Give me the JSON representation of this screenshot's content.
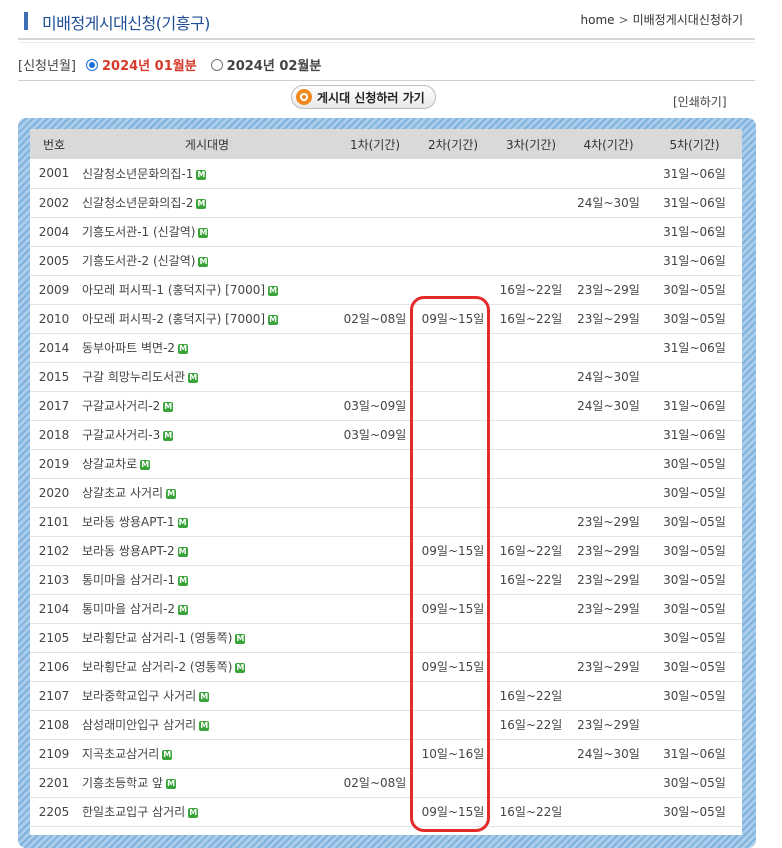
{
  "header": {
    "title": "미배정게시대신청(기흥구)",
    "breadcrumb_home": "home",
    "breadcrumb_sep": ">",
    "breadcrumb_current": "미배정게시대신청하기"
  },
  "month_select": {
    "label": "[신청년월]",
    "options": [
      {
        "label": "2024년 01월분",
        "selected": true
      },
      {
        "label": "2024년 02월분",
        "selected": false
      }
    ]
  },
  "actions": {
    "apply_label": "게시대 신청하러 가기",
    "print_label": "[인쇄하기]"
  },
  "table": {
    "columns": [
      "번호",
      "게시대명",
      "1차(기간)",
      "2차(기간)",
      "3차(기간)",
      "4차(기간)",
      "5차(기간)"
    ],
    "badge": "M",
    "rows": [
      {
        "no": "2001",
        "name": "신갈청소년문화의집-1",
        "p1": "",
        "p2": "",
        "p3": "",
        "p4": "",
        "p5": "31일~06일"
      },
      {
        "no": "2002",
        "name": "신갈청소년문화의집-2",
        "p1": "",
        "p2": "",
        "p3": "",
        "p4": "24일~30일",
        "p5": "31일~06일"
      },
      {
        "no": "2004",
        "name": "기흥도서관-1 (신갈역)",
        "p1": "",
        "p2": "",
        "p3": "",
        "p4": "",
        "p5": "31일~06일"
      },
      {
        "no": "2005",
        "name": "기흥도서관-2 (신갈역)",
        "p1": "",
        "p2": "",
        "p3": "",
        "p4": "",
        "p5": "31일~06일"
      },
      {
        "no": "2009",
        "name": "아모레 퍼시픽-1 (홍덕지구) [7000]",
        "p1": "",
        "p2": "",
        "p3": "16일~22일",
        "p4": "23일~29일",
        "p5": "30일~05일"
      },
      {
        "no": "2010",
        "name": "아모레 퍼시픽-2 (홍덕지구) [7000]",
        "p1": "02일~08일",
        "p2": "09일~15일",
        "p3": "16일~22일",
        "p4": "23일~29일",
        "p5": "30일~05일"
      },
      {
        "no": "2014",
        "name": "동부아파트 벽면-2",
        "p1": "",
        "p2": "",
        "p3": "",
        "p4": "",
        "p5": "31일~06일"
      },
      {
        "no": "2015",
        "name": "구갈 희망누리도서관",
        "p1": "",
        "p2": "",
        "p3": "",
        "p4": "24일~30일",
        "p5": ""
      },
      {
        "no": "2017",
        "name": "구갈교사거리-2",
        "p1": "03일~09일",
        "p2": "",
        "p3": "",
        "p4": "24일~30일",
        "p5": "31일~06일"
      },
      {
        "no": "2018",
        "name": "구갈교사거리-3",
        "p1": "03일~09일",
        "p2": "",
        "p3": "",
        "p4": "",
        "p5": "31일~06일"
      },
      {
        "no": "2019",
        "name": "상갈교차로",
        "p1": "",
        "p2": "",
        "p3": "",
        "p4": "",
        "p5": "30일~05일"
      },
      {
        "no": "2020",
        "name": "상갈초교 사거리",
        "p1": "",
        "p2": "",
        "p3": "",
        "p4": "",
        "p5": "30일~05일"
      },
      {
        "no": "2101",
        "name": "보라동 쌍용APT-1",
        "p1": "",
        "p2": "",
        "p3": "",
        "p4": "23일~29일",
        "p5": "30일~05일"
      },
      {
        "no": "2102",
        "name": "보라동 쌍용APT-2",
        "p1": "",
        "p2": "09일~15일",
        "p3": "16일~22일",
        "p4": "23일~29일",
        "p5": "30일~05일"
      },
      {
        "no": "2103",
        "name": "통미마을 삼거리-1",
        "p1": "",
        "p2": "",
        "p3": "16일~22일",
        "p4": "23일~29일",
        "p5": "30일~05일"
      },
      {
        "no": "2104",
        "name": "통미마을 삼거리-2",
        "p1": "",
        "p2": "09일~15일",
        "p3": "",
        "p4": "23일~29일",
        "p5": "30일~05일"
      },
      {
        "no": "2105",
        "name": "보라횡단교 삼거리-1 (영통쪽)",
        "p1": "",
        "p2": "",
        "p3": "",
        "p4": "",
        "p5": "30일~05일"
      },
      {
        "no": "2106",
        "name": "보라횡단교 삼거리-2 (영통쪽)",
        "p1": "",
        "p2": "09일~15일",
        "p3": "",
        "p4": "23일~29일",
        "p5": "30일~05일"
      },
      {
        "no": "2107",
        "name": "보라중학교입구 사거리",
        "p1": "",
        "p2": "",
        "p3": "16일~22일",
        "p4": "",
        "p5": "30일~05일"
      },
      {
        "no": "2108",
        "name": "삼성래미안입구 삼거리",
        "p1": "",
        "p2": "",
        "p3": "16일~22일",
        "p4": "23일~29일",
        "p5": ""
      },
      {
        "no": "2109",
        "name": "지곡초교삼거리",
        "p1": "",
        "p2": "10일~16일",
        "p3": "",
        "p4": "24일~30일",
        "p5": "31일~06일"
      },
      {
        "no": "2201",
        "name": "기흥초등학교 앞",
        "p1": "02일~08일",
        "p2": "",
        "p3": "",
        "p4": "",
        "p5": "30일~05일"
      },
      {
        "no": "2205",
        "name": "한일초교입구 삼거리",
        "p1": "",
        "p2": "09일~15일",
        "p3": "16일~22일",
        "p4": "",
        "p5": "30일~05일"
      }
    ]
  }
}
